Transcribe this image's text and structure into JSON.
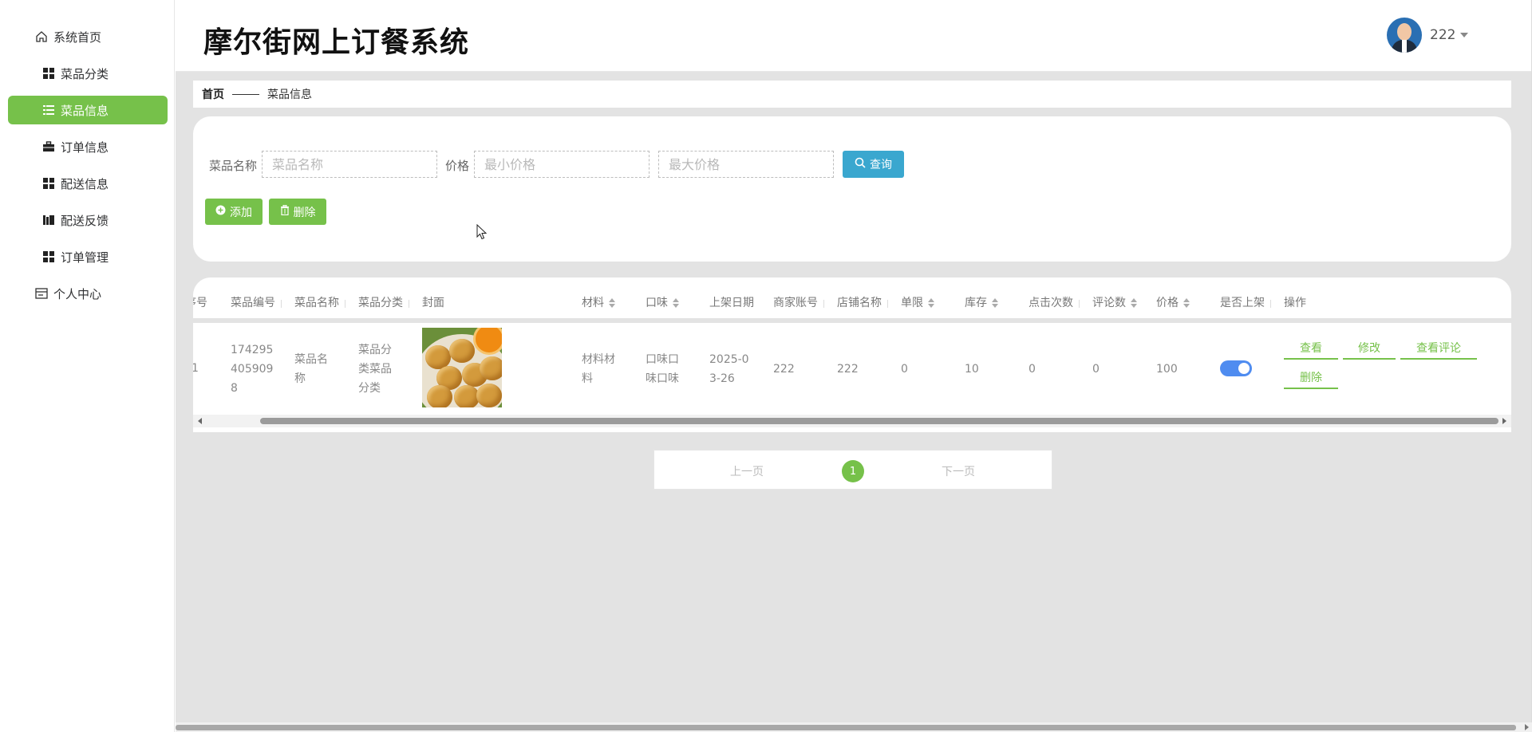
{
  "app": {
    "title": "摩尔街网上订餐系统"
  },
  "user": {
    "name": "222"
  },
  "sidebar": {
    "items": [
      {
        "label": "系统首页",
        "icon": "home-icon"
      },
      {
        "label": "菜品分类",
        "icon": "grid-icon"
      },
      {
        "label": "菜品信息",
        "icon": "list-icon",
        "active": true
      },
      {
        "label": "订单信息",
        "icon": "briefcase-icon"
      },
      {
        "label": "配送信息",
        "icon": "grid-icon"
      },
      {
        "label": "配送反馈",
        "icon": "books-icon"
      },
      {
        "label": "订单管理",
        "icon": "grid-icon"
      },
      {
        "label": "个人中心",
        "icon": "card-icon"
      }
    ]
  },
  "breadcrumb": {
    "home": "首页",
    "current": "菜品信息"
  },
  "search": {
    "name_label": "菜品名称",
    "name_placeholder": "菜品名称",
    "price_label": "价格",
    "min_placeholder": "最小价格",
    "max_placeholder": "最大价格",
    "query_label": "查询",
    "add_label": "添加",
    "delete_label": "删除"
  },
  "table": {
    "headers": [
      "序号",
      "菜品编号",
      "菜品名称",
      "菜品分类",
      "封面",
      "材料",
      "口味",
      "上架日期",
      "商家账号",
      "店铺名称",
      "单限",
      "库存",
      "点击次数",
      "评论数",
      "价格",
      "是否上架",
      "操作"
    ],
    "rows": [
      {
        "index": "1",
        "code_lines": [
          "174295",
          "405909",
          "8"
        ],
        "name_lines": [
          "菜品名",
          "称"
        ],
        "category_lines": [
          "菜品分",
          "类菜品",
          "分类"
        ],
        "material_lines": [
          "材料材",
          "料"
        ],
        "taste_lines": [
          "口味口",
          "味口味"
        ],
        "date_lines": [
          "2025-0",
          "3-26"
        ],
        "merchant": "222",
        "shop": "222",
        "limit": "0",
        "stock": "10",
        "clicks": "0",
        "comments": "0",
        "price": "100",
        "on_shelf": true,
        "actions": {
          "view": "查看",
          "edit": "修改",
          "view_comments": "查看评论",
          "delete": "删除"
        }
      }
    ]
  },
  "pagination": {
    "prev": "上一页",
    "page": "1",
    "next": "下一页"
  },
  "colors": {
    "accent": "#76c14a",
    "query": "#3aa7cf",
    "toggle": "#4f8cf0",
    "background": "#e3e3e3"
  }
}
